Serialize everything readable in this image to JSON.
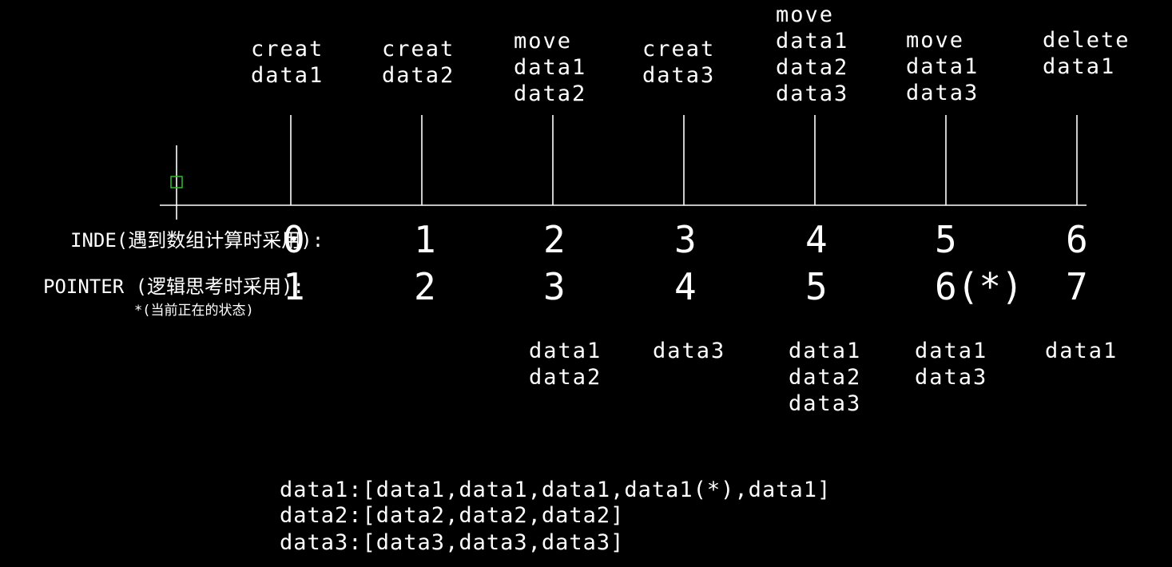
{
  "operations": [
    [
      "creat",
      "data1"
    ],
    [
      "creat",
      "data2"
    ],
    [
      "move",
      "data1",
      "data2"
    ],
    [
      "creat",
      "data3"
    ],
    [
      "move",
      "data1",
      "data2",
      "data3"
    ],
    [
      "move",
      "data1",
      "data3"
    ],
    [
      "delete",
      "data1"
    ]
  ],
  "index_values": [
    "0",
    "1",
    "2",
    "3",
    "4",
    "5",
    "6"
  ],
  "pointer_values": [
    "1",
    "2",
    "3",
    "4",
    "5",
    "6(*)",
    "7"
  ],
  "labels": {
    "index": "INDE(遇到数组计算时采用):",
    "pointer": "POINTER (逻辑思考时采用):",
    "current_state_note": "*(当前正在的状态)"
  },
  "states": [
    [],
    [],
    [
      "data1",
      "data2"
    ],
    [
      "data3"
    ],
    [
      "data1",
      "data2",
      "data3"
    ],
    [
      "data1",
      "data3"
    ],
    [
      "data1"
    ]
  ],
  "summary": [
    "data1:[data1,data1,data1,data1(*),data1]",
    "data2:[data2,data2,data2]",
    "data3:[data3,data3,data3]"
  ],
  "colors": {
    "background": "#000000",
    "foreground": "#ffffff",
    "cursor_marker": "#2bbf2b"
  }
}
